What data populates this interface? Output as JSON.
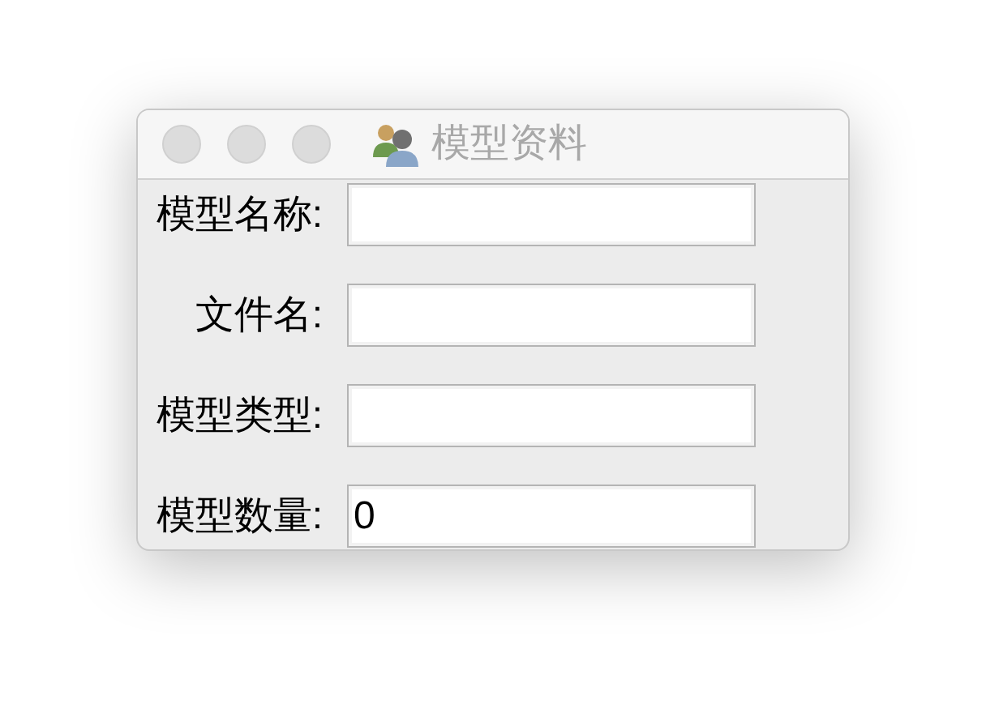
{
  "window": {
    "title": "模型资料"
  },
  "fields": [
    {
      "label": "模型名称:"
    },
    {
      "label": "文件名:"
    },
    {
      "label": "模型类型:"
    },
    {
      "label": "模型数量:",
      "value": "0"
    }
  ]
}
